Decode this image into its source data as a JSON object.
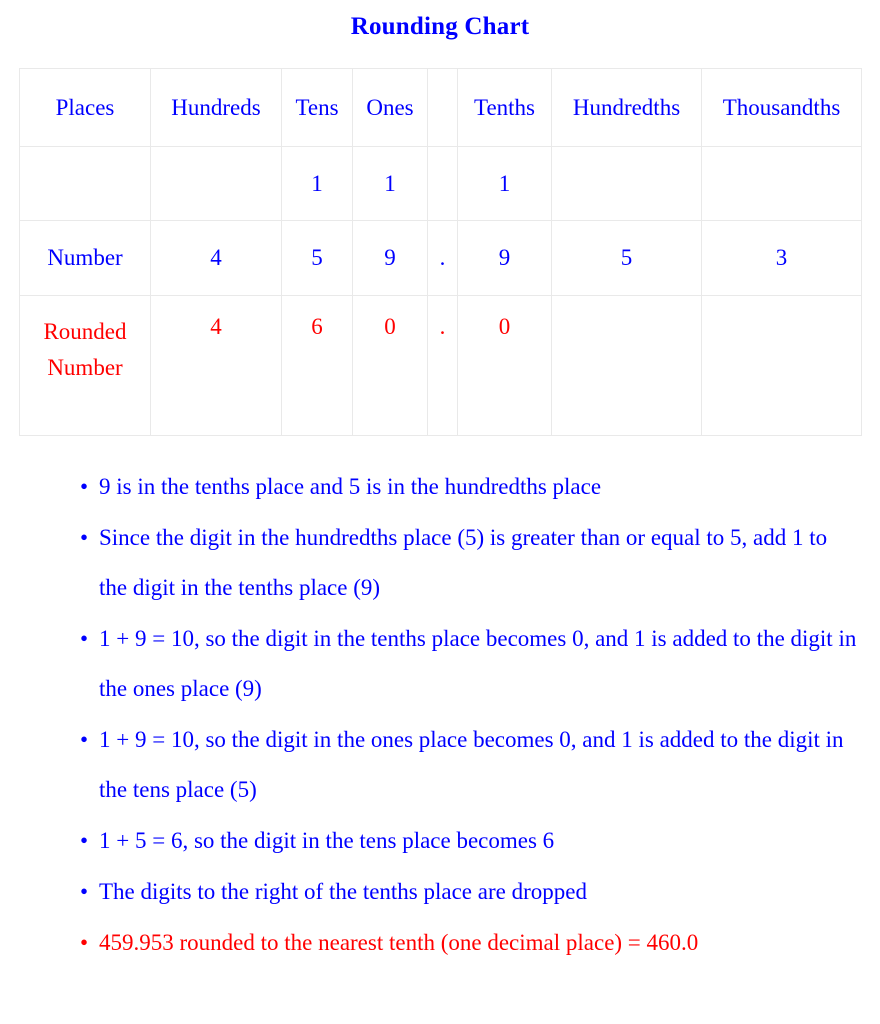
{
  "title": "Rounding Chart",
  "colors": {
    "primary_blue": "#0000FF",
    "accent_red": "#FF0000",
    "border_gray": "#E9E9E9",
    "background": "#FFFFFF"
  },
  "chart_data": {
    "type": "table",
    "title": "Rounding Chart",
    "columns": [
      "Places",
      "Hundreds",
      "Tens",
      "Ones",
      "",
      "Tenths",
      "Hundredths",
      "Thousandths"
    ],
    "rows": [
      {
        "label": "",
        "label_color": "#0000FF",
        "cells": [
          "",
          "",
          "1",
          "1",
          "",
          "1",
          "",
          ""
        ],
        "cell_color": "#0000FF"
      },
      {
        "label": "Number",
        "label_color": "#0000FF",
        "cells": [
          "",
          "4",
          "5",
          "9",
          ".",
          "9",
          "5",
          "3"
        ],
        "cell_color": "#0000FF"
      },
      {
        "label": "Rounded Number",
        "label_color": "#FF0000",
        "cells": [
          "",
          "4",
          "6",
          "0",
          ".",
          "0",
          "",
          ""
        ],
        "cell_color": "#FF0000"
      }
    ],
    "original_number": "459.953",
    "rounded_number": "460.0",
    "rounding_target": "nearest tenth (one decimal place)"
  },
  "table": {
    "header": {
      "places": "Places",
      "hundreds": "Hundreds",
      "tens": "Tens",
      "ones": "Ones",
      "decimal": "",
      "tenths": "Tenths",
      "hundredths": "Hundredths",
      "thousandths": "Thousandths"
    },
    "carry_row": {
      "label": "",
      "hundreds": "",
      "tens": "1",
      "ones": "1",
      "decimal": "",
      "tenths": "1",
      "hundredths": "",
      "thousandths": ""
    },
    "number_row": {
      "label": "Number",
      "hundreds": "4",
      "tens": "5",
      "ones": "9",
      "decimal": ".",
      "tenths": "9",
      "hundredths": "5",
      "thousandths": "3"
    },
    "rounded_row": {
      "label": "Rounded Number",
      "hundreds": "4",
      "tens": "6",
      "ones": "0",
      "decimal": ".",
      "tenths": "0",
      "hundredths": "",
      "thousandths": ""
    }
  },
  "notes": {
    "bullet": "•",
    "items": [
      {
        "text": "9 is in the tenths place and 5 is in the hundredths place",
        "color": "#0000FF"
      },
      {
        "text": "Since the digit in the hundredths place (5) is greater than or equal to 5, add 1 to the digit in the tenths place (9)",
        "color": "#0000FF"
      },
      {
        "text": "1 + 9 = 10, so the digit in the tenths place becomes 0, and 1 is added to the digit in the ones place (9)",
        "color": "#0000FF"
      },
      {
        "text": "1 + 9 = 10, so the digit in the ones place becomes 0, and 1 is added to the digit in the tens place (5)",
        "color": "#0000FF"
      },
      {
        "text": "1 + 5 = 6, so the digit in the tens place becomes 6",
        "color": "#0000FF"
      },
      {
        "text": "The digits to the right of the tenths place are dropped",
        "color": "#0000FF"
      },
      {
        "text": "459.953 rounded to the nearest tenth (one decimal place) = 460.0",
        "color": "#FF0000"
      }
    ]
  }
}
